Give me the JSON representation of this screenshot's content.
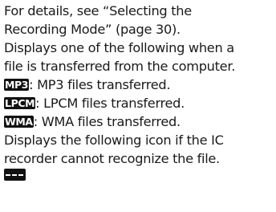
{
  "lines": [
    "For details, see “Selecting the",
    "Recording Mode” (page 30).",
    "Displays one of the following when a",
    "file is transferred from the computer."
  ],
  "formats": [
    {
      "badge": "MP3",
      "text": ": MP3 files transferred."
    },
    {
      "badge": "LPCM",
      "text": ": LPCM files transferred."
    },
    {
      "badge": "WMA",
      "text": ": WMA files transferred."
    }
  ],
  "unrecognized": [
    "Displays the following icon if the IC",
    "recorder cannot recognize the file."
  ],
  "unknown_icon_name": "unrecognized-file-icon"
}
